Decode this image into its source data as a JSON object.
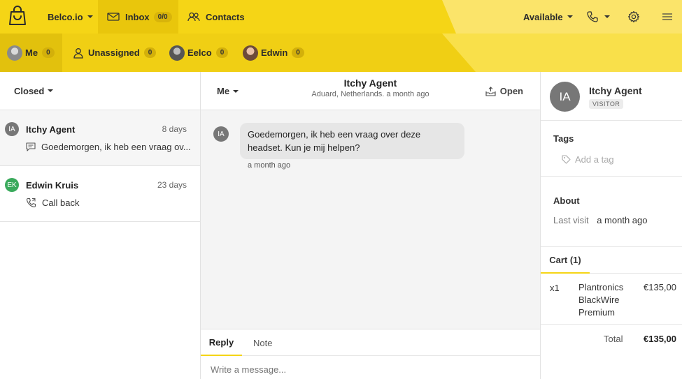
{
  "topbar": {
    "brand": "Belco.io",
    "inbox_label": "Inbox",
    "inbox_count": "0/0",
    "contacts_label": "Contacts",
    "status": "Available"
  },
  "agents": {
    "me": {
      "label": "Me",
      "count": "0"
    },
    "unassigned": {
      "label": "Unassigned",
      "count": "0"
    },
    "eelco": {
      "label": "Eelco",
      "count": "0"
    },
    "edwin": {
      "label": "Edwin",
      "count": "0"
    }
  },
  "conversations": {
    "filter": "Closed",
    "items": [
      {
        "initials": "IA",
        "name": "Itchy Agent",
        "time": "8 days",
        "snippet": "Goedemorgen, ik heb een vraag ov...",
        "avatar_color": "#777777"
      },
      {
        "initials": "EK",
        "name": "Edwin Kruis",
        "time": "23 days",
        "snippet": "Call back",
        "avatar_color": "#3aaa5c"
      }
    ]
  },
  "conversation": {
    "assignee": "Me",
    "title": "Itchy Agent",
    "subtitle": "Aduard, Netherlands. a month ago",
    "open_label": "Open",
    "message": {
      "initials": "IA",
      "text": "Goedemorgen, ik heb een vraag over deze headset. Kun je mij helpen?",
      "time": "a month ago"
    },
    "composer": {
      "reply_tab": "Reply",
      "note_tab": "Note",
      "placeholder": "Write a message..."
    }
  },
  "visitor": {
    "initials": "IA",
    "name": "Itchy Agent",
    "type": "VISITOR",
    "tags_title": "Tags",
    "add_tag": "Add a tag",
    "about_title": "About",
    "last_visit_label": "Last visit",
    "last_visit_value": "a month ago",
    "cart": {
      "tab": "Cart (1)",
      "items": [
        {
          "qty": "x1",
          "product": "Plantronics BlackWire Premium",
          "price": "€135,00"
        }
      ],
      "total_label": "Total",
      "total_value": "€135,00"
    }
  },
  "colors": {
    "accent": "#f5d516",
    "visitor_avatar": "#777777",
    "edwin_avatar": "#3aaa5c"
  }
}
